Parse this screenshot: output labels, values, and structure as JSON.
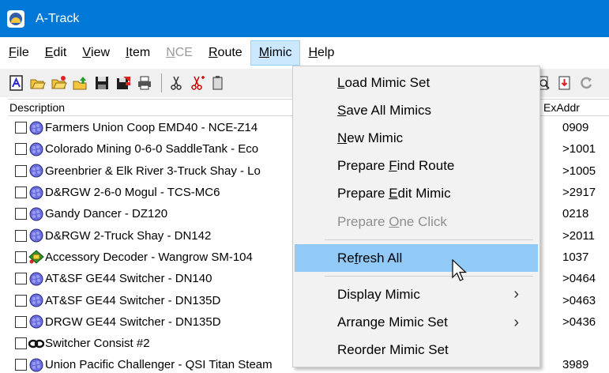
{
  "window": {
    "title": "A-Track",
    "app_icon": "atrack-logo-icon"
  },
  "menubar": {
    "items": [
      {
        "label": "File",
        "underline_index": 0,
        "disabled": false
      },
      {
        "label": "Edit",
        "underline_index": 0,
        "disabled": false
      },
      {
        "label": "View",
        "underline_index": 0,
        "disabled": false
      },
      {
        "label": "Item",
        "underline_index": 0,
        "disabled": false
      },
      {
        "label": "NCE",
        "underline_index": 0,
        "disabled": true
      },
      {
        "label": "Route",
        "underline_index": 0,
        "disabled": false
      },
      {
        "label": "Mimic",
        "underline_index": 0,
        "disabled": false,
        "active": true
      },
      {
        "label": "Help",
        "underline_index": 0,
        "disabled": false
      }
    ]
  },
  "toolbar": {
    "icons": [
      "new-mimic-icon",
      "open-folder-icon",
      "open-folder-alt-icon",
      "upload-folder-icon",
      "save-icon",
      "save-all-icon",
      "print-icon",
      "cut-icon",
      "cut-special-icon",
      "paste-icon"
    ],
    "right_icons": [
      "find-icon",
      "export-icon",
      "refresh-icon"
    ]
  },
  "list": {
    "columns": {
      "description": "Description",
      "exaddr": "ExAddr"
    },
    "rows": [
      {
        "description": "Farmers Union Coop EMD40 - NCE-Z14",
        "exaddr": "0909",
        "icon": "loco-icon"
      },
      {
        "description": "Colorado Mining 0-6-0 SaddleTank - Eco",
        "exaddr": ">1001",
        "icon": "loco-icon"
      },
      {
        "description": "Greenbrier & Elk River 3-Truck Shay - Lo",
        "exaddr": ">1005",
        "icon": "loco-icon"
      },
      {
        "description": "D&RGW 2-6-0 Mogul - TCS-MC6",
        "exaddr": ">2917",
        "icon": "loco-icon"
      },
      {
        "description": "Gandy Dancer - DZ120",
        "exaddr": "0218",
        "icon": "loco-icon"
      },
      {
        "description": "D&RGW 2-Truck Shay - DN142",
        "exaddr": ">2011",
        "icon": "loco-icon"
      },
      {
        "description": "Accessory Decoder - Wangrow SM-104",
        "exaddr": "1037",
        "icon": "accessory-decoder-icon"
      },
      {
        "description": "AT&SF GE44 Switcher - DN140",
        "exaddr": ">0464",
        "icon": "loco-icon"
      },
      {
        "description": "AT&SF GE44 Switcher - DN135D",
        "exaddr": ">0463",
        "icon": "loco-icon"
      },
      {
        "description": "DRGW GE44 Switcher - DN135D",
        "exaddr": ">0436",
        "icon": "loco-icon"
      },
      {
        "description": "Switcher Consist #2",
        "exaddr": "",
        "icon": "consist-icon"
      },
      {
        "description": "Union Pacific Challenger - QSI Titan Steam",
        "exaddr": "3989",
        "icon": "loco-icon"
      }
    ]
  },
  "mimic_menu": {
    "items": [
      {
        "label": "Load Mimic Set",
        "underline_index": 0,
        "disabled": false
      },
      {
        "label": "Save All Mimics",
        "underline_index": 0,
        "disabled": false
      },
      {
        "label": "New Mimic",
        "underline_index": 0,
        "disabled": false
      },
      {
        "label": "Prepare Find Route",
        "underline_index": 8,
        "disabled": false
      },
      {
        "label": "Prepare Edit Mimic",
        "underline_index": 8,
        "disabled": false
      },
      {
        "label": "Prepare One Click",
        "underline_index": 8,
        "disabled": true
      },
      {
        "separator": true
      },
      {
        "label": "Refresh All",
        "underline_index": 2,
        "disabled": false,
        "highlighted": true
      },
      {
        "separator": true
      },
      {
        "label": "Display Mimic",
        "underline_index": -1,
        "disabled": false,
        "submenu": true
      },
      {
        "label": "Arrange Mimic Set",
        "underline_index": -1,
        "disabled": false,
        "submenu": true
      },
      {
        "label": "Reorder Mimic Set",
        "underline_index": -1,
        "disabled": false
      }
    ]
  },
  "colors": {
    "titlebar": "#0078d7",
    "menu_highlight": "#91c9f7",
    "menu_active": "#cce8ff"
  }
}
